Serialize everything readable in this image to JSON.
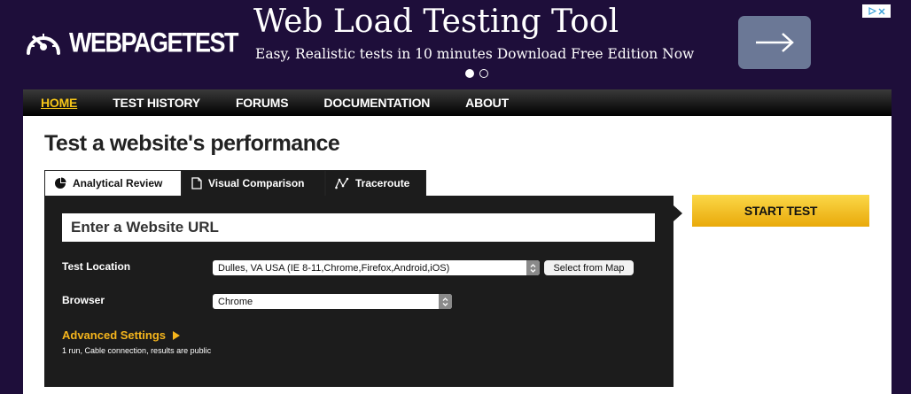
{
  "logo": {
    "text": "WEBPAGETEST"
  },
  "ad": {
    "title": "Web Load Testing Tool",
    "subtitle": "Easy, Realistic tests in 10 minutes Download Free Edition Now",
    "arrow_icon": "arrow-right-icon",
    "choices_icon": "adchoices-icon",
    "slide_count": 2,
    "active_slide": 1
  },
  "nav": {
    "items": [
      {
        "label": "HOME",
        "active": true
      },
      {
        "label": "TEST HISTORY"
      },
      {
        "label": "FORUMS"
      },
      {
        "label": "DOCUMENTATION"
      },
      {
        "label": "ABOUT"
      }
    ]
  },
  "main": {
    "title": "Test a website's performance",
    "tabs": [
      {
        "label": "Analytical Review",
        "icon": "pie-chart-icon",
        "active": true
      },
      {
        "label": "Visual Comparison",
        "icon": "document-icon"
      },
      {
        "label": "Traceroute",
        "icon": "traceroute-icon"
      }
    ],
    "url_placeholder": "Enter a Website URL",
    "test_location": {
      "label": "Test Location",
      "value": "Dulles, VA USA (IE 8-11,Chrome,Firefox,Android,iOS)",
      "map_button": "Select from Map"
    },
    "browser": {
      "label": "Browser",
      "value": "Chrome"
    },
    "advanced": {
      "label": "Advanced Settings",
      "summary": "1 run, Cable connection, results are public"
    },
    "start_button": "START TEST"
  },
  "colors": {
    "background": "#1e0e3a",
    "accent": "#f5c518",
    "panel": "#1c1c1c",
    "ad_button": "#6b7896"
  }
}
